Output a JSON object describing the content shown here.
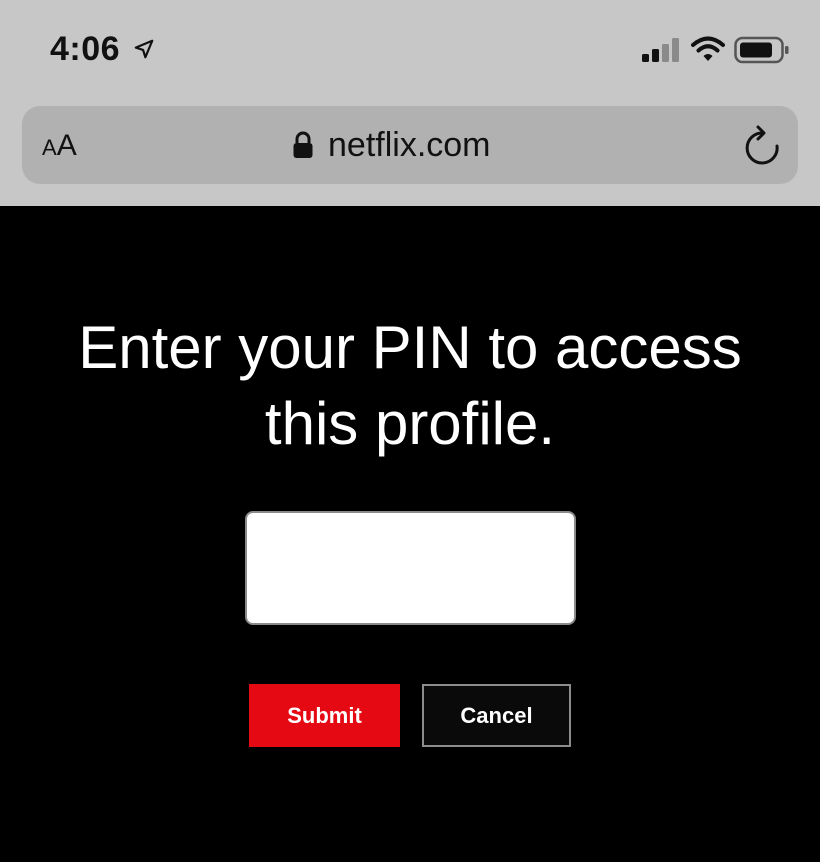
{
  "status_bar": {
    "time": "4:06",
    "icons": [
      "location-arrow-icon",
      "cellular-signal-icon",
      "wifi-icon",
      "battery-icon"
    ]
  },
  "address_bar": {
    "text_size_label_small": "A",
    "text_size_label_large": "A",
    "url": "netflix.com",
    "icons": [
      "lock-icon",
      "reload-icon"
    ]
  },
  "pin_prompt": {
    "title": "Enter your PIN to access this profile.",
    "pin_value": "",
    "submit_label": "Submit",
    "cancel_label": "Cancel"
  },
  "colors": {
    "chrome_background": "#c7c7c7",
    "address_bar_background": "#b1b1b1",
    "page_background": "#000000",
    "submit_red": "#e50914",
    "text_white": "#ffffff"
  }
}
